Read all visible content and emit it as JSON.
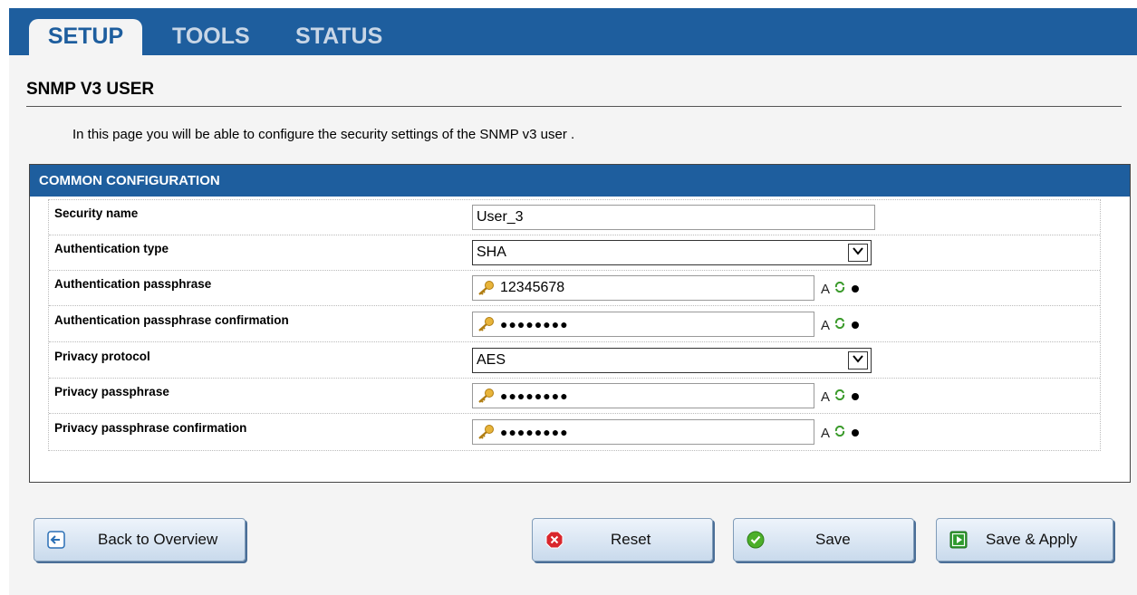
{
  "tabs": [
    {
      "label": "SETUP",
      "active": true
    },
    {
      "label": "TOOLS",
      "active": false
    },
    {
      "label": "STATUS",
      "active": false
    }
  ],
  "page": {
    "title": "SNMP V3 USER",
    "intro": "In this page you will be able to configure the security settings of the SNMP v3 user ."
  },
  "panel": {
    "header": "COMMON CONFIGURATION",
    "rows": [
      {
        "label": "Security name",
        "type": "text",
        "value": "User_3"
      },
      {
        "label": "Authentication type",
        "type": "select",
        "value": "SHA"
      },
      {
        "label": "Authentication passphrase",
        "type": "password-visible",
        "value": "12345678",
        "tool_text": "A"
      },
      {
        "label": "Authentication passphrase confirmation",
        "type": "password",
        "value": "●●●●●●●●",
        "tool_text": "A"
      },
      {
        "label": "Privacy protocol",
        "type": "select",
        "value": "AES"
      },
      {
        "label": "Privacy passphrase",
        "type": "password",
        "value": "●●●●●●●●",
        "tool_text": "A"
      },
      {
        "label": "Privacy passphrase confirmation",
        "type": "password",
        "value": "●●●●●●●●",
        "tool_text": "A"
      }
    ]
  },
  "buttons": {
    "back": "Back to Overview",
    "reset": "Reset",
    "save": "Save",
    "save_apply": "Save & Apply"
  },
  "colors": {
    "brand_blue": "#1e5e9e",
    "reset_icon": "#d9262c",
    "save_icon": "#4caf2a",
    "apply_icon": "#2e9a2e"
  }
}
